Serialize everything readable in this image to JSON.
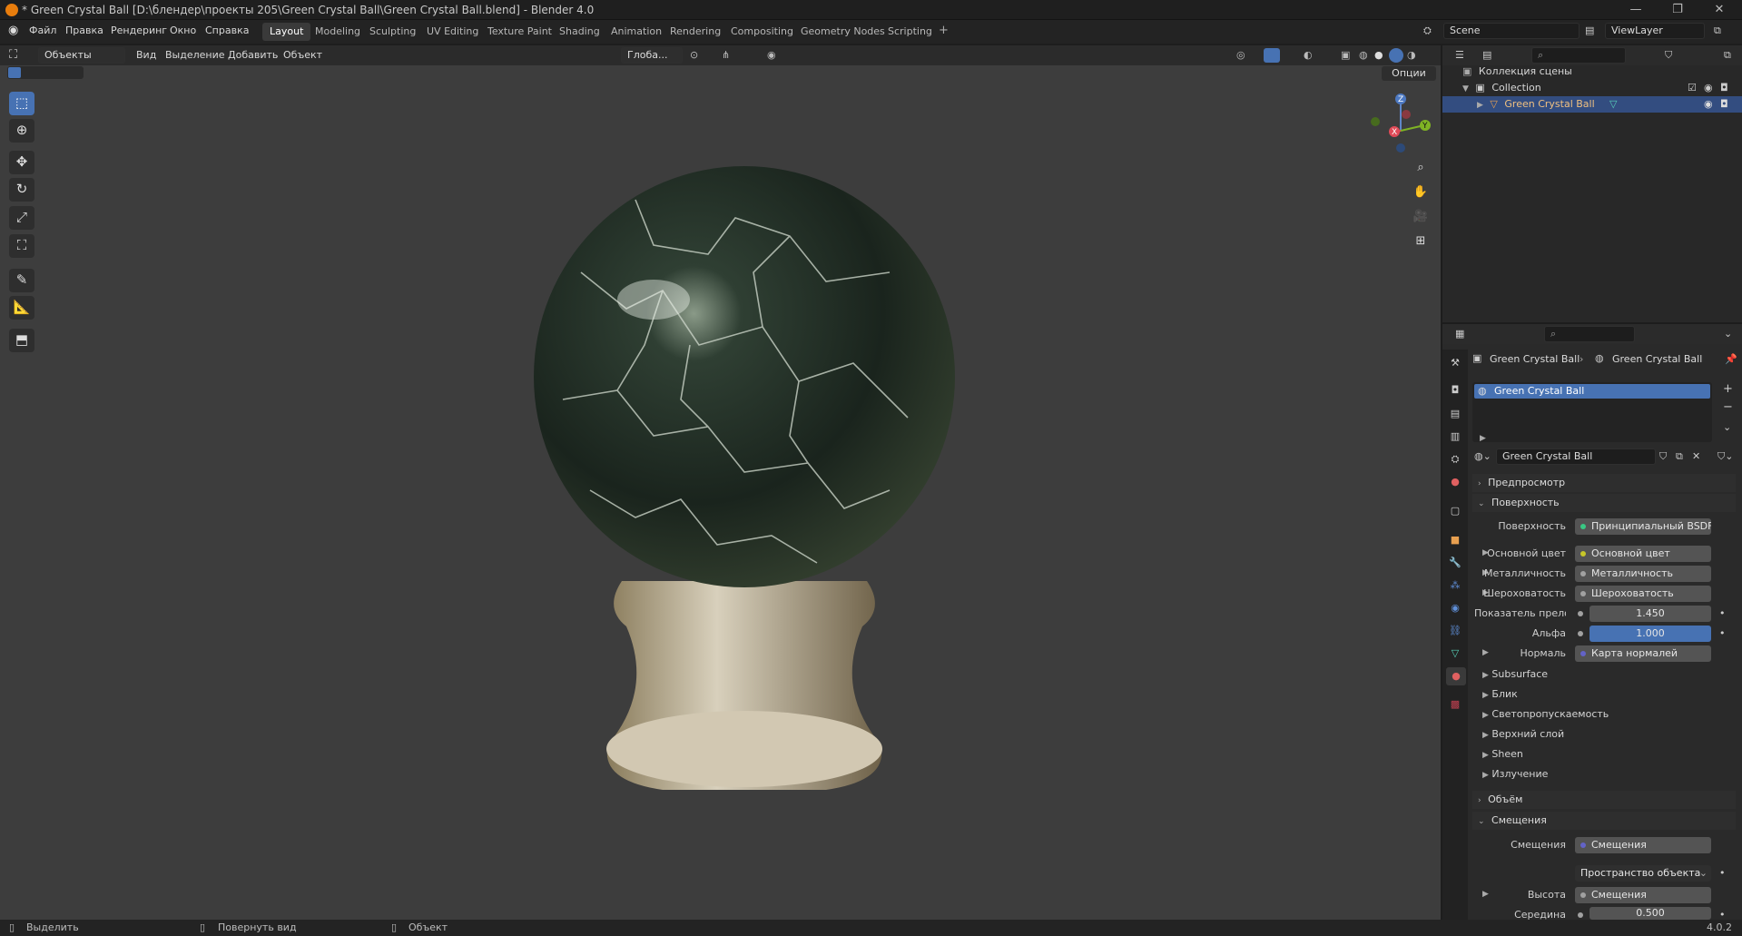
{
  "window": {
    "title": "* Green Crystal Ball [D:\\блендер\\проекты 205\\Green Crystal Ball\\Green Crystal Ball.blend] - Blender 4.0"
  },
  "menu": [
    "Файл",
    "Правка",
    "Рендеринг",
    "Окно",
    "Справка"
  ],
  "workspaces": [
    "Layout",
    "Modeling",
    "Sculpting",
    "UV Editing",
    "Texture Paint",
    "Shading",
    "Animation",
    "Rendering",
    "Compositing",
    "Geometry Nodes",
    "Scripting"
  ],
  "active_workspace": "Layout",
  "scene": "Scene",
  "view_layer": "ViewLayer",
  "viewport": {
    "mode": "Объекты",
    "menus": [
      "Вид",
      "Выделение",
      "Добавить",
      "Объект"
    ],
    "transform_orientation": "Глоба...",
    "options": "Опции"
  },
  "gizmo": {
    "x": "X",
    "y": "Y",
    "z": "Z"
  },
  "outliner": {
    "scene_collection": "Коллекция сцены",
    "collection": "Collection",
    "object": "Green Crystal Ball"
  },
  "properties": {
    "breadcrumb_object": "Green Crystal Ball",
    "breadcrumb_material": "Green Crystal Ball",
    "slot": "Green Crystal Ball",
    "material_name": "Green Crystal Ball",
    "panels": {
      "preview": "Предпросмотр",
      "surface": "Поверхность",
      "volume": "Объём",
      "displacement": "Смещения"
    },
    "surface_label": "Поверхность",
    "surface_value": "Принципиальный BSDF",
    "inputs": [
      {
        "label": "Основной цвет",
        "value": "Основной цвет",
        "dot": "#c7c729"
      },
      {
        "label": "Металличность",
        "value": "Металличность",
        "dot": "#a1a1a1"
      },
      {
        "label": "Шероховатость",
        "value": "Шероховатость",
        "dot": "#a1a1a1"
      },
      {
        "label": "Показатель прело...",
        "value": "1.450",
        "dot": "#a1a1a1"
      },
      {
        "label": "Альфа",
        "value": "1.000",
        "dot": "#a1a1a1"
      },
      {
        "label": "Нормаль",
        "value": "Карта нормалей",
        "dot": "#6363c7"
      }
    ],
    "subpanels": [
      "Subsurface",
      "Блик",
      "Светопропускаемость",
      "Верхний слой",
      "Sheen",
      "Излучение"
    ],
    "displacement_rows": {
      "displacement_label": "Смещения",
      "displacement_value": "Смещения",
      "space_value": "Пространство объекта",
      "height_label": "Высота",
      "height_value": "Смещения",
      "midlevel_label": "Середина",
      "midlevel_value": "0.500"
    }
  },
  "statusbar": {
    "select": "Выделить",
    "rotate": "Повернуть вид",
    "object": "Объект",
    "version": "4.0.2"
  }
}
